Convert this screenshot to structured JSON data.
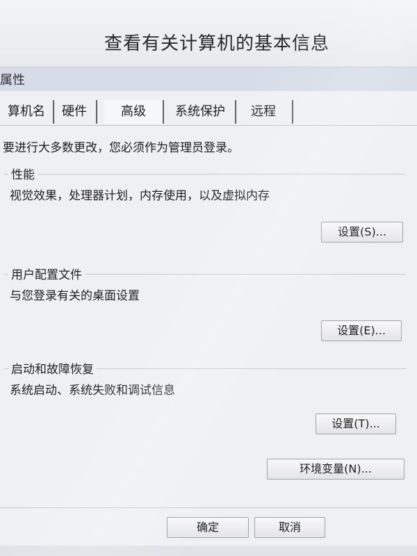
{
  "background_window": {
    "title": "查看有关计算机的基本信息"
  },
  "dialog": {
    "title": "属性",
    "tabs": [
      {
        "label": "算机名"
      },
      {
        "label": "硬件"
      },
      {
        "label": "高级"
      },
      {
        "label": "系统保护"
      },
      {
        "label": "远程"
      }
    ],
    "notice": "要进行大多数更改，您必须作为管理员登录。",
    "groups": [
      {
        "title": "性能",
        "description": "视觉效果，处理器计划，内存使用，以及虚拟内存",
        "button": "设置(S)..."
      },
      {
        "title": "用户配置文件",
        "description": "与您登录有关的桌面设置",
        "button": "设置(E)..."
      },
      {
        "title": "启动和故障恢复",
        "description": "系统启动、系统失败和调试信息",
        "button": "设置(T)..."
      }
    ],
    "env_button": "环境变量(N)...",
    "ok_button": "确定",
    "cancel_button": "取消"
  }
}
